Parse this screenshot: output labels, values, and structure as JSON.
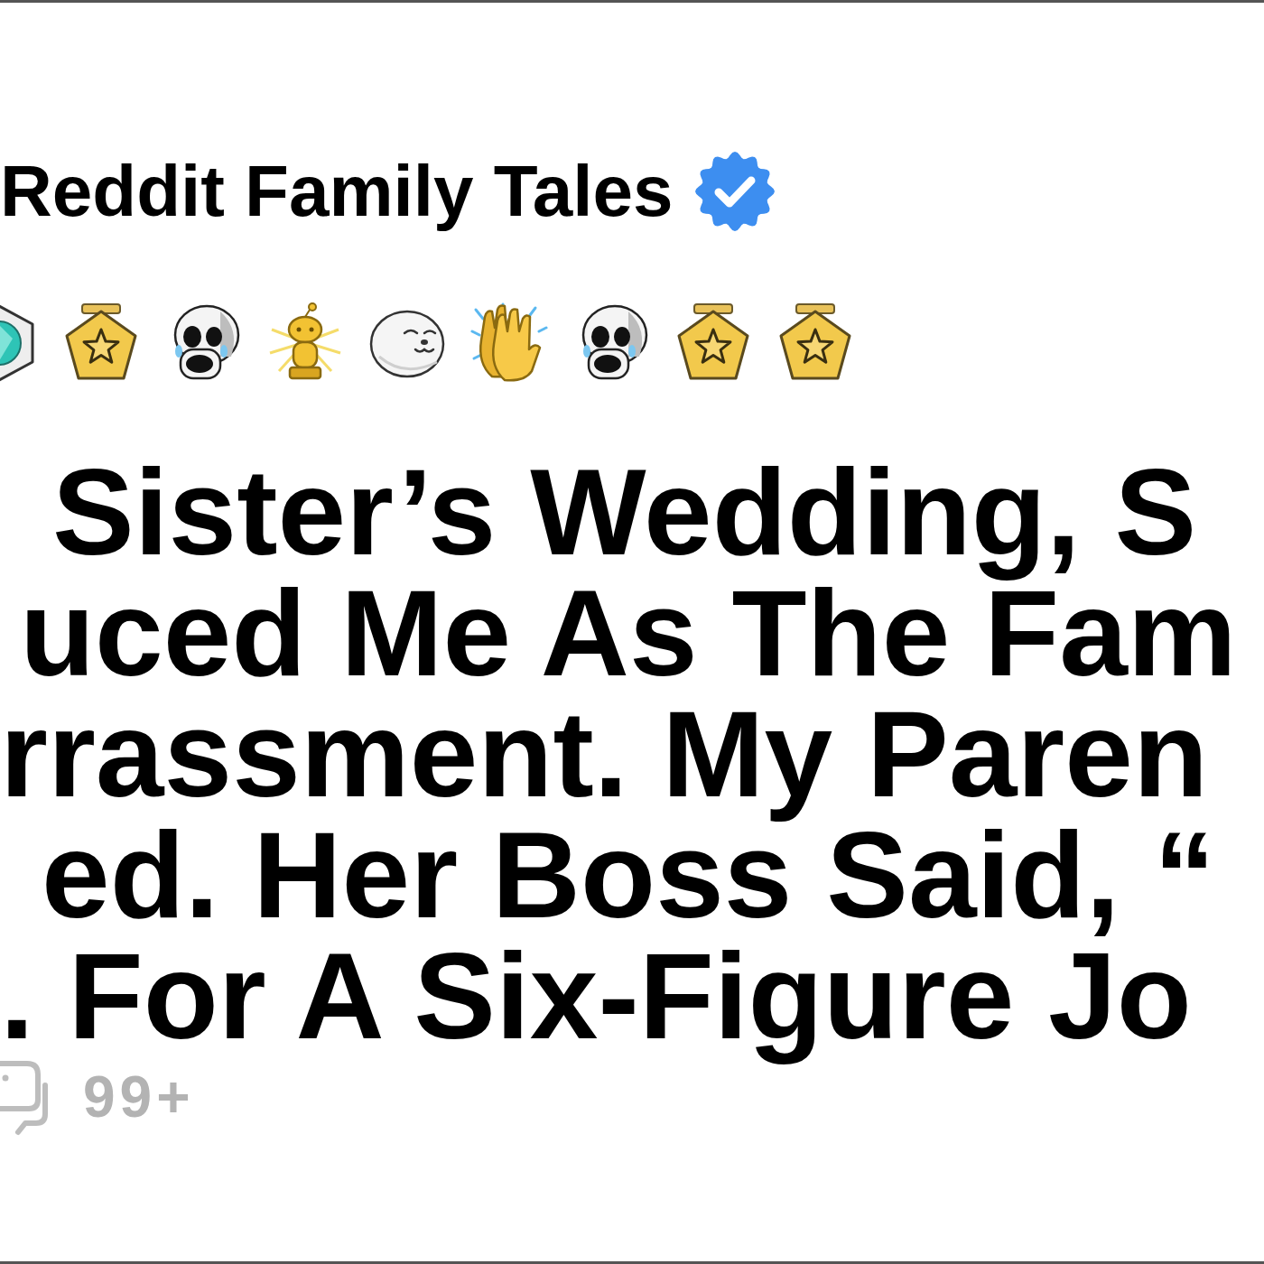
{
  "header": {
    "name": "Reddit Family Tales",
    "verified": true
  },
  "awards": [
    {
      "kind": "gem"
    },
    {
      "kind": "star"
    },
    {
      "kind": "skull"
    },
    {
      "kind": "trophy"
    },
    {
      "kind": "seal"
    },
    {
      "kind": "clap"
    },
    {
      "kind": "skull"
    },
    {
      "kind": "star"
    },
    {
      "kind": "star"
    }
  ],
  "title_lines": [
    "Sister’s Wedding, S",
    "uced Me As The Fam",
    "rrassment. My Paren",
    "ed. Her Boss Said, “",
    ". For A Six-Figure Jo"
  ],
  "comments": {
    "count": "99+"
  }
}
